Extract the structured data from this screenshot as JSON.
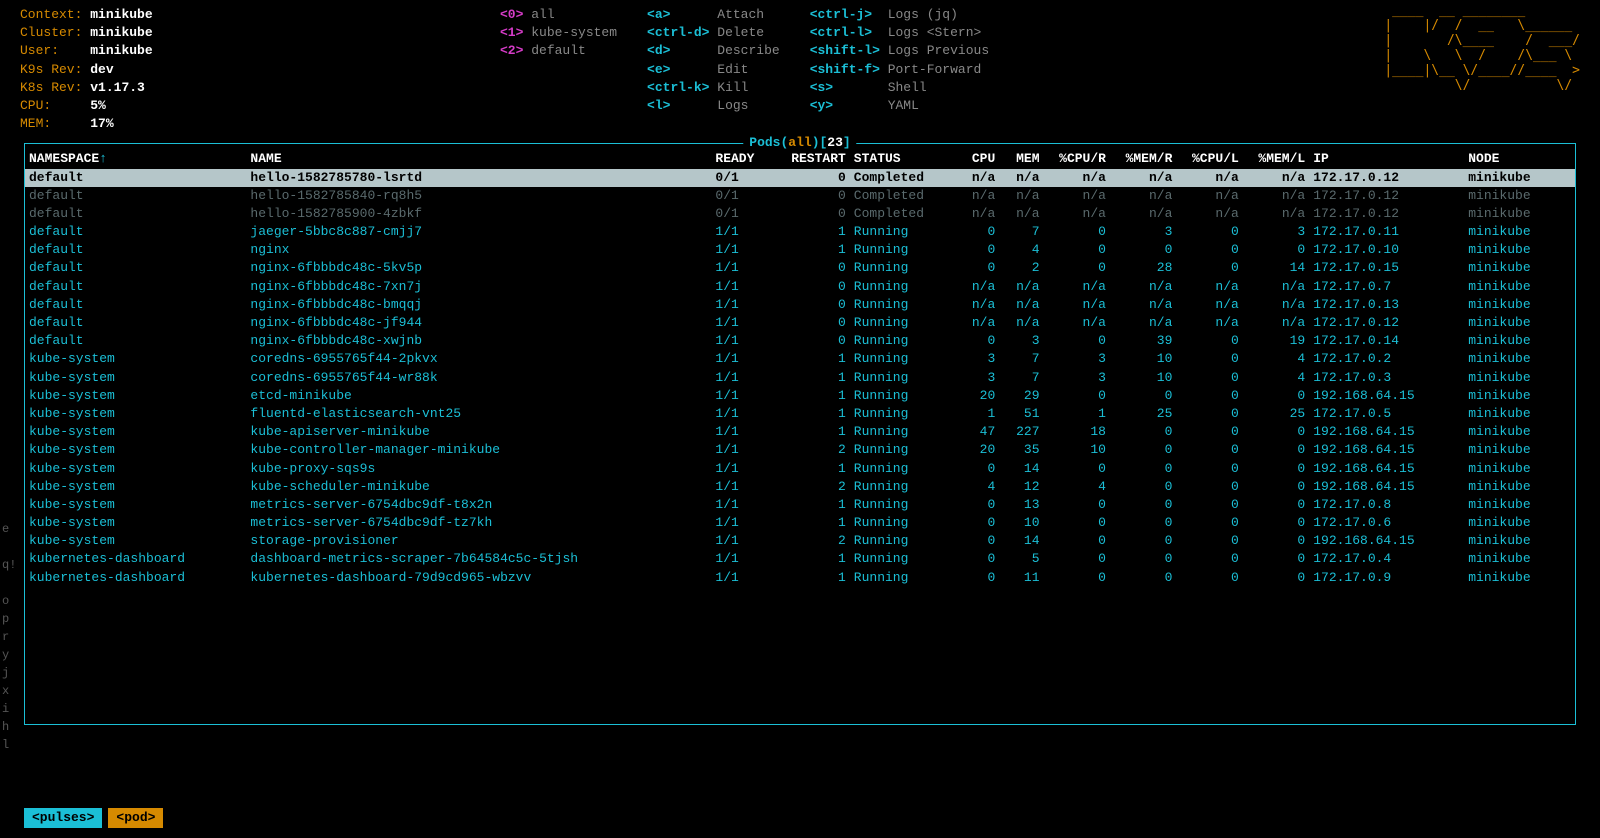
{
  "clusterInfo": {
    "context_label": "Context:",
    "context_value": "minikube",
    "cluster_label": "Cluster:",
    "cluster_value": "minikube",
    "user_label": "User:",
    "user_value": "minikube",
    "k9srev_label": "K9s Rev:",
    "k9srev_value": "dev",
    "k8srev_label": "K8s Rev:",
    "k8srev_value": "v1.17.3",
    "cpu_label": "CPU:",
    "cpu_value": "5%",
    "mem_label": "MEM:",
    "mem_value": "17%"
  },
  "shortcuts": {
    "col1": [
      {
        "key": "<0>",
        "action": "all",
        "style": "magenta"
      },
      {
        "key": "<1>",
        "action": "kube-system",
        "style": "magenta"
      },
      {
        "key": "<2>",
        "action": "default",
        "style": "magenta"
      }
    ],
    "col2": [
      {
        "key": "<a>",
        "action": "Attach",
        "style": "cyan"
      },
      {
        "key": "<ctrl-d>",
        "action": "Delete",
        "style": "cyan"
      },
      {
        "key": "<d>",
        "action": "Describe",
        "style": "cyan"
      },
      {
        "key": "<e>",
        "action": "Edit",
        "style": "cyan"
      },
      {
        "key": "<ctrl-k>",
        "action": "Kill",
        "style": "cyan"
      },
      {
        "key": "<l>",
        "action": "Logs",
        "style": "cyan"
      }
    ],
    "col3": [
      {
        "key": "<ctrl-j>",
        "action": "Logs (jq)",
        "style": "cyan"
      },
      {
        "key": "<ctrl-l>",
        "action": "Logs <Stern>",
        "style": "cyan"
      },
      {
        "key": "<shift-l>",
        "action": "Logs Previous",
        "style": "cyan"
      },
      {
        "key": "<shift-f>",
        "action": "Port-Forward",
        "style": "cyan"
      },
      {
        "key": "<s>",
        "action": "Shell",
        "style": "cyan"
      },
      {
        "key": "<y>",
        "action": "YAML",
        "style": "cyan"
      }
    ]
  },
  "logo": " ____  __ ________       \n|    |/  /  __   \\______\n|       /\\____    /  ___/\n|    \\   \\  /    /\\___ \\ \n|____|\\__ \\/____//____  >\n         \\/           \\/ ",
  "tableTitle": {
    "prefix": "Pods(",
    "mid": "all",
    "suffix": ")[",
    "count": "23",
    "close": "]"
  },
  "columns": [
    "NAMESPACE",
    "NAME",
    "READY",
    "RESTART",
    "STATUS",
    "CPU",
    "MEM",
    "%CPU/R",
    "%MEM/R",
    "%CPU/L",
    "%MEM/L",
    "IP",
    "NODE"
  ],
  "rows": [
    {
      "sel": true,
      "dim": false,
      "ns": "default",
      "name": "hello-1582785780-lsrtd",
      "ready": "0/1",
      "restart": "0",
      "status": "Completed",
      "cpu": "n/a",
      "mem": "n/a",
      "cpur": "n/a",
      "memr": "n/a",
      "cpul": "n/a",
      "meml": "n/a",
      "ip": "172.17.0.12",
      "node": "minikube"
    },
    {
      "sel": false,
      "dim": true,
      "ns": "default",
      "name": "hello-1582785840-rq8h5",
      "ready": "0/1",
      "restart": "0",
      "status": "Completed",
      "cpu": "n/a",
      "mem": "n/a",
      "cpur": "n/a",
      "memr": "n/a",
      "cpul": "n/a",
      "meml": "n/a",
      "ip": "172.17.0.12",
      "node": "minikube"
    },
    {
      "sel": false,
      "dim": true,
      "ns": "default",
      "name": "hello-1582785900-4zbkf",
      "ready": "0/1",
      "restart": "0",
      "status": "Completed",
      "cpu": "n/a",
      "mem": "n/a",
      "cpur": "n/a",
      "memr": "n/a",
      "cpul": "n/a",
      "meml": "n/a",
      "ip": "172.17.0.12",
      "node": "minikube"
    },
    {
      "sel": false,
      "dim": false,
      "ns": "default",
      "name": "jaeger-5bbc8c887-cmjj7",
      "ready": "1/1",
      "restart": "1",
      "status": "Running",
      "cpu": "0",
      "mem": "7",
      "cpur": "0",
      "memr": "3",
      "cpul": "0",
      "meml": "3",
      "ip": "172.17.0.11",
      "node": "minikube"
    },
    {
      "sel": false,
      "dim": false,
      "ns": "default",
      "name": "nginx",
      "ready": "1/1",
      "restart": "1",
      "status": "Running",
      "cpu": "0",
      "mem": "4",
      "cpur": "0",
      "memr": "0",
      "cpul": "0",
      "meml": "0",
      "ip": "172.17.0.10",
      "node": "minikube"
    },
    {
      "sel": false,
      "dim": false,
      "ns": "default",
      "name": "nginx-6fbbbdc48c-5kv5p",
      "ready": "1/1",
      "restart": "0",
      "status": "Running",
      "cpu": "0",
      "mem": "2",
      "cpur": "0",
      "memr": "28",
      "cpul": "0",
      "meml": "14",
      "ip": "172.17.0.15",
      "node": "minikube"
    },
    {
      "sel": false,
      "dim": false,
      "ns": "default",
      "name": "nginx-6fbbbdc48c-7xn7j",
      "ready": "1/1",
      "restart": "0",
      "status": "Running",
      "cpu": "n/a",
      "mem": "n/a",
      "cpur": "n/a",
      "memr": "n/a",
      "cpul": "n/a",
      "meml": "n/a",
      "ip": "172.17.0.7",
      "node": "minikube"
    },
    {
      "sel": false,
      "dim": false,
      "ns": "default",
      "name": "nginx-6fbbbdc48c-bmqqj",
      "ready": "1/1",
      "restart": "0",
      "status": "Running",
      "cpu": "n/a",
      "mem": "n/a",
      "cpur": "n/a",
      "memr": "n/a",
      "cpul": "n/a",
      "meml": "n/a",
      "ip": "172.17.0.13",
      "node": "minikube"
    },
    {
      "sel": false,
      "dim": false,
      "ns": "default",
      "name": "nginx-6fbbbdc48c-jf944",
      "ready": "1/1",
      "restart": "0",
      "status": "Running",
      "cpu": "n/a",
      "mem": "n/a",
      "cpur": "n/a",
      "memr": "n/a",
      "cpul": "n/a",
      "meml": "n/a",
      "ip": "172.17.0.12",
      "node": "minikube"
    },
    {
      "sel": false,
      "dim": false,
      "ns": "default",
      "name": "nginx-6fbbbdc48c-xwjnb",
      "ready": "1/1",
      "restart": "0",
      "status": "Running",
      "cpu": "0",
      "mem": "3",
      "cpur": "0",
      "memr": "39",
      "cpul": "0",
      "meml": "19",
      "ip": "172.17.0.14",
      "node": "minikube"
    },
    {
      "sel": false,
      "dim": false,
      "ns": "kube-system",
      "name": "coredns-6955765f44-2pkvx",
      "ready": "1/1",
      "restart": "1",
      "status": "Running",
      "cpu": "3",
      "mem": "7",
      "cpur": "3",
      "memr": "10",
      "cpul": "0",
      "meml": "4",
      "ip": "172.17.0.2",
      "node": "minikube"
    },
    {
      "sel": false,
      "dim": false,
      "ns": "kube-system",
      "name": "coredns-6955765f44-wr88k",
      "ready": "1/1",
      "restart": "1",
      "status": "Running",
      "cpu": "3",
      "mem": "7",
      "cpur": "3",
      "memr": "10",
      "cpul": "0",
      "meml": "4",
      "ip": "172.17.0.3",
      "node": "minikube"
    },
    {
      "sel": false,
      "dim": false,
      "ns": "kube-system",
      "name": "etcd-minikube",
      "ready": "1/1",
      "restart": "1",
      "status": "Running",
      "cpu": "20",
      "mem": "29",
      "cpur": "0",
      "memr": "0",
      "cpul": "0",
      "meml": "0",
      "ip": "192.168.64.15",
      "node": "minikube"
    },
    {
      "sel": false,
      "dim": false,
      "ns": "kube-system",
      "name": "fluentd-elasticsearch-vnt25",
      "ready": "1/1",
      "restart": "1",
      "status": "Running",
      "cpu": "1",
      "mem": "51",
      "cpur": "1",
      "memr": "25",
      "cpul": "0",
      "meml": "25",
      "ip": "172.17.0.5",
      "node": "minikube"
    },
    {
      "sel": false,
      "dim": false,
      "ns": "kube-system",
      "name": "kube-apiserver-minikube",
      "ready": "1/1",
      "restart": "1",
      "status": "Running",
      "cpu": "47",
      "mem": "227",
      "cpur": "18",
      "memr": "0",
      "cpul": "0",
      "meml": "0",
      "ip": "192.168.64.15",
      "node": "minikube"
    },
    {
      "sel": false,
      "dim": false,
      "ns": "kube-system",
      "name": "kube-controller-manager-minikube",
      "ready": "1/1",
      "restart": "2",
      "status": "Running",
      "cpu": "20",
      "mem": "35",
      "cpur": "10",
      "memr": "0",
      "cpul": "0",
      "meml": "0",
      "ip": "192.168.64.15",
      "node": "minikube"
    },
    {
      "sel": false,
      "dim": false,
      "ns": "kube-system",
      "name": "kube-proxy-sqs9s",
      "ready": "1/1",
      "restart": "1",
      "status": "Running",
      "cpu": "0",
      "mem": "14",
      "cpur": "0",
      "memr": "0",
      "cpul": "0",
      "meml": "0",
      "ip": "192.168.64.15",
      "node": "minikube"
    },
    {
      "sel": false,
      "dim": false,
      "ns": "kube-system",
      "name": "kube-scheduler-minikube",
      "ready": "1/1",
      "restart": "2",
      "status": "Running",
      "cpu": "4",
      "mem": "12",
      "cpur": "4",
      "memr": "0",
      "cpul": "0",
      "meml": "0",
      "ip": "192.168.64.15",
      "node": "minikube"
    },
    {
      "sel": false,
      "dim": false,
      "ns": "kube-system",
      "name": "metrics-server-6754dbc9df-t8x2n",
      "ready": "1/1",
      "restart": "1",
      "status": "Running",
      "cpu": "0",
      "mem": "13",
      "cpur": "0",
      "memr": "0",
      "cpul": "0",
      "meml": "0",
      "ip": "172.17.0.8",
      "node": "minikube"
    },
    {
      "sel": false,
      "dim": false,
      "ns": "kube-system",
      "name": "metrics-server-6754dbc9df-tz7kh",
      "ready": "1/1",
      "restart": "1",
      "status": "Running",
      "cpu": "0",
      "mem": "10",
      "cpur": "0",
      "memr": "0",
      "cpul": "0",
      "meml": "0",
      "ip": "172.17.0.6",
      "node": "minikube"
    },
    {
      "sel": false,
      "dim": false,
      "ns": "kube-system",
      "name": "storage-provisioner",
      "ready": "1/1",
      "restart": "2",
      "status": "Running",
      "cpu": "0",
      "mem": "14",
      "cpur": "0",
      "memr": "0",
      "cpul": "0",
      "meml": "0",
      "ip": "192.168.64.15",
      "node": "minikube"
    },
    {
      "sel": false,
      "dim": false,
      "ns": "kubernetes-dashboard",
      "name": "dashboard-metrics-scraper-7b64584c5c-5tjsh",
      "ready": "1/1",
      "restart": "1",
      "status": "Running",
      "cpu": "0",
      "mem": "5",
      "cpur": "0",
      "memr": "0",
      "cpul": "0",
      "meml": "0",
      "ip": "172.17.0.4",
      "node": "minikube"
    },
    {
      "sel": false,
      "dim": false,
      "ns": "kubernetes-dashboard",
      "name": "kubernetes-dashboard-79d9cd965-wbzvv",
      "ready": "1/1",
      "restart": "1",
      "status": "Running",
      "cpu": "0",
      "mem": "11",
      "cpur": "0",
      "memr": "0",
      "cpul": "0",
      "meml": "0",
      "ip": "172.17.0.9",
      "node": "minikube"
    }
  ],
  "gutter": [
    "e",
    "",
    "q!",
    "",
    "o",
    "p",
    "r",
    "y",
    "j",
    "x",
    "i",
    "h",
    "l"
  ],
  "crumbs": [
    {
      "label": "<pulses>",
      "cls": "crumb-cyan"
    },
    {
      "label": "<pod>",
      "cls": "crumb-orange"
    }
  ]
}
